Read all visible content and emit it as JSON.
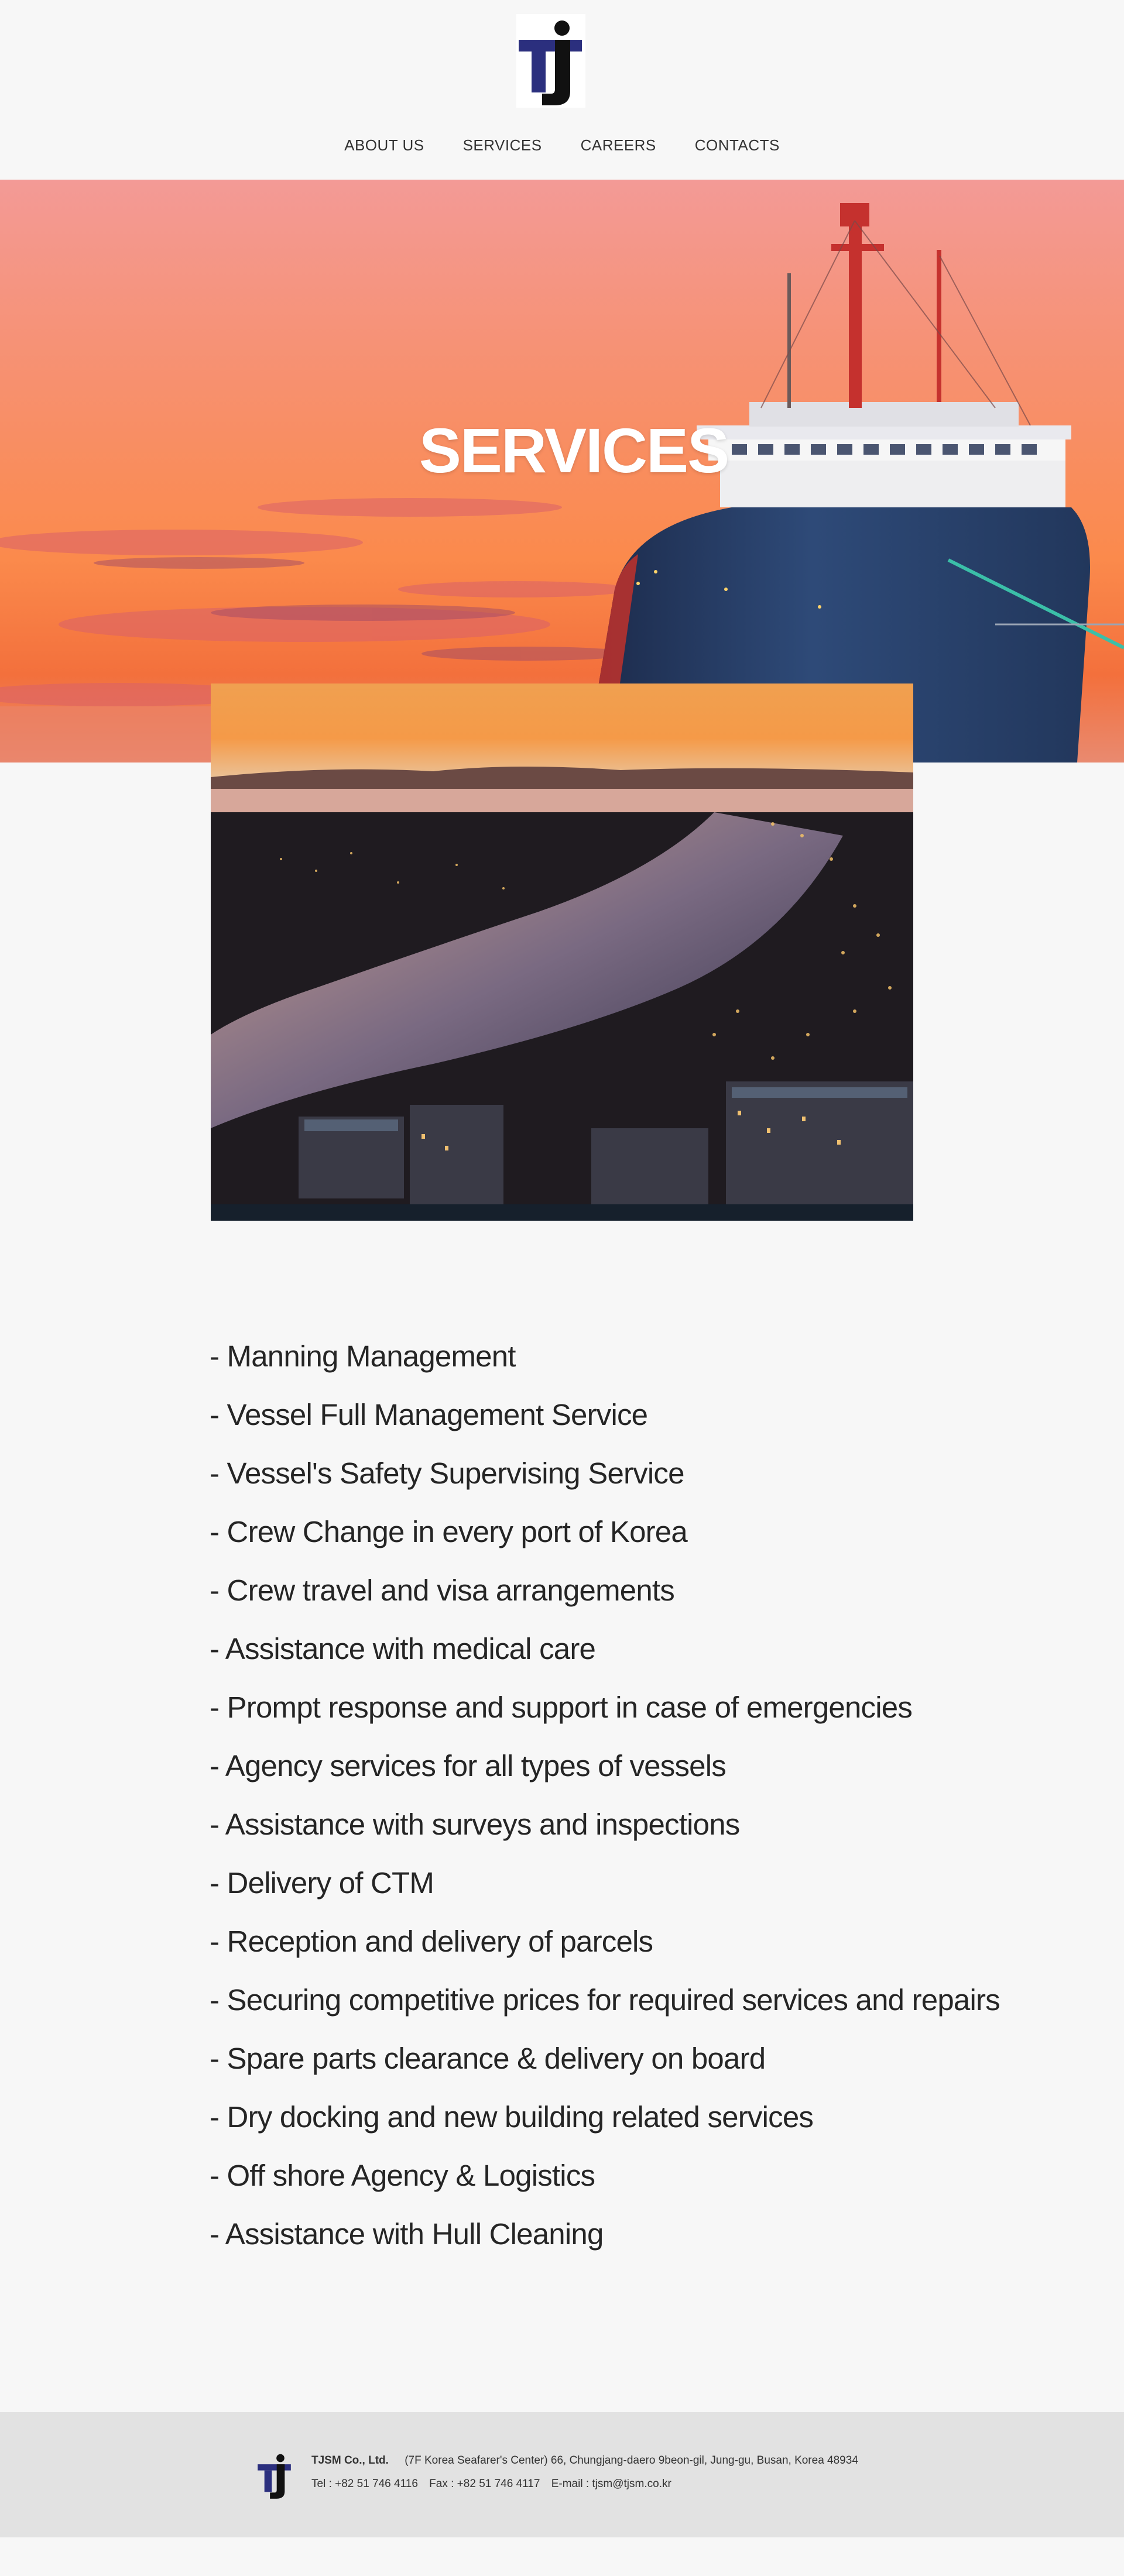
{
  "header": {
    "logo_alt": "TJ",
    "nav": [
      {
        "label": "ABOUT US"
      },
      {
        "label": "SERVICES"
      },
      {
        "label": "CAREERS"
      },
      {
        "label": "CONTACTS"
      }
    ]
  },
  "hero": {
    "title": "SERVICES"
  },
  "services": [
    "- Manning Management",
    "- Vessel Full Management Service",
    "- Vessel's Safety Supervising Service",
    "- Crew Change in every port of Korea",
    "- Crew travel and visa arrangements",
    "- Assistance with medical care",
    "- Prompt response and support in case of emergencies",
    "- Agency services for all types of vessels",
    "- Assistance with surveys and inspections",
    "- Delivery of CTM",
    "- Reception and delivery of parcels",
    "- Securing competitive prices for required services and repairs",
    "- Spare parts clearance & delivery on board",
    "- Dry docking and new building related services",
    "- Off shore Agency & Logistics",
    "- Assistance with Hull Cleaning"
  ],
  "footer": {
    "company": "TJSM Co., Ltd.",
    "address": "(7F Korea Seafarer's Center) 66, Chungjang-daero 9beon-gil, Jung-gu, Busan, Korea 48934",
    "tel": "Tel : +82 51 746 4116",
    "fax": "Fax : +82 51 746 4117",
    "email": "E-mail : tjsm@tjsm.co.kr"
  },
  "colors": {
    "logo_blue": "#2b2f7e",
    "logo_black": "#111111",
    "page_bg": "#f7f7f7",
    "footer_bg": "#e2e2e2"
  }
}
